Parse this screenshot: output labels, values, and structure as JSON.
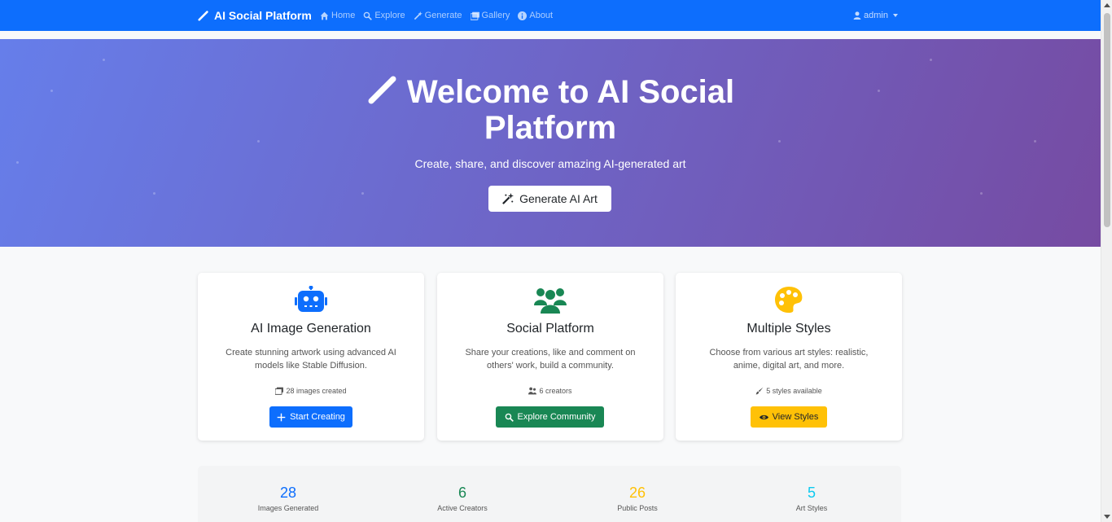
{
  "navbar": {
    "brand": "AI Social Platform",
    "links": [
      {
        "label": "Home",
        "icon": "home-icon"
      },
      {
        "label": "Explore",
        "icon": "search-icon"
      },
      {
        "label": "Generate",
        "icon": "wand-icon"
      },
      {
        "label": "Gallery",
        "icon": "images-icon"
      },
      {
        "label": "About",
        "icon": "info-icon"
      }
    ],
    "user": "admin"
  },
  "hero": {
    "title": "Welcome to AI Social Platform",
    "subtitle": "Create, share, and discover amazing AI-generated art",
    "cta": "Generate AI Art"
  },
  "features": [
    {
      "icon": "robot-icon",
      "title": "AI Image Generation",
      "description": "Create stunning artwork using advanced AI models like Stable Diffusion.",
      "stat": "28 images created",
      "stat_icon": "images-icon",
      "button": "Start Creating",
      "button_icon": "plus-icon",
      "color": "#0d6efd"
    },
    {
      "icon": "users-icon",
      "title": "Social Platform",
      "description": "Share your creations, like and comment on others' work, build a community.",
      "stat": "6 creators",
      "stat_icon": "users-icon",
      "button": "Explore Community",
      "button_icon": "search-icon",
      "color": "#198754"
    },
    {
      "icon": "palette-icon",
      "title": "Multiple Styles",
      "description": "Choose from various art styles: realistic, anime, digital art, and more.",
      "stat": "5 styles available",
      "stat_icon": "brush-icon",
      "button": "View Styles",
      "button_icon": "eye-icon",
      "color": "#ffc107"
    }
  ],
  "stats": [
    {
      "value": "28",
      "label": "Images Generated",
      "color": "#0d6efd"
    },
    {
      "value": "6",
      "label": "Active Creators",
      "color": "#198754"
    },
    {
      "value": "26",
      "label": "Public Posts",
      "color": "#ffc107"
    },
    {
      "value": "5",
      "label": "Art Styles",
      "color": "#0dcaf0"
    }
  ]
}
